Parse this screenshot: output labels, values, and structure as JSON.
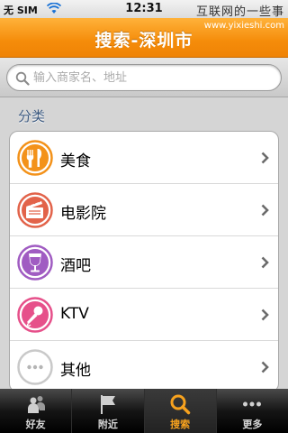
{
  "status_bar": {
    "carrier": "无 SIM",
    "time": "12:31",
    "watermark": "互联网的一些事"
  },
  "nav": {
    "title": "搜索-深圳市",
    "url": "www.yixieshi.com"
  },
  "search": {
    "placeholder": "输入商家名、地址",
    "value": ""
  },
  "section_title": "分类",
  "categories": [
    {
      "label": "美食",
      "icon": "food-icon",
      "color": "#f3921a"
    },
    {
      "label": "电影院",
      "icon": "movie-clapper-icon",
      "color": "#e2634a"
    },
    {
      "label": "酒吧",
      "icon": "wine-glass-icon",
      "color": "#a05cc2"
    },
    {
      "label": "KTV",
      "icon": "microphone-icon",
      "color": "#e6508a"
    },
    {
      "label": "其他",
      "icon": "more-dots-icon",
      "color": "#c9c9c9"
    }
  ],
  "tabs": [
    {
      "label": "好友",
      "icon": "friends-icon",
      "active": false
    },
    {
      "label": "附近",
      "icon": "flag-icon",
      "active": false
    },
    {
      "label": "搜索",
      "icon": "search-icon",
      "active": true
    },
    {
      "label": "更多",
      "icon": "more-icon",
      "active": false
    }
  ],
  "colors": {
    "nav_orange": "#f58c0a",
    "tab_active": "#f7a21e",
    "section_text": "#3d5a80"
  }
}
